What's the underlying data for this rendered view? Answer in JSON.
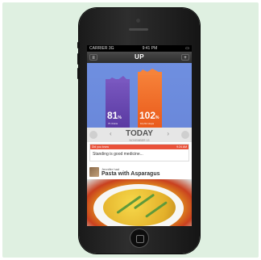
{
  "status_bar": {
    "carrier": "CARRIER",
    "network": "3G",
    "time": "9:41 PM"
  },
  "navbar": {
    "title": "UP",
    "menu_icon": "hamburger-menu-icon",
    "add_icon": "plus-icon",
    "menu_glyph": "≡",
    "add_glyph": "+"
  },
  "chart": {
    "sleep": {
      "value": "81",
      "unit": "%",
      "label": "7h 3mins"
    },
    "move": {
      "value": "102",
      "unit": "%",
      "label": "10,214 steps"
    },
    "colors": {
      "sleep": "#6a48b4",
      "move": "#f0702a",
      "background": "#6c8bdc"
    }
  },
  "today": {
    "title": "TODAY",
    "date": "NOVEMBER 13",
    "prev": "‹",
    "next": "›"
  },
  "tip_card": {
    "header": "Did you know",
    "time": "9:24 AM",
    "body": "Standing is good medicine..."
  },
  "meal": {
    "who": "Jennifer",
    "action": "had",
    "dish": "Pasta with Asparagus"
  }
}
